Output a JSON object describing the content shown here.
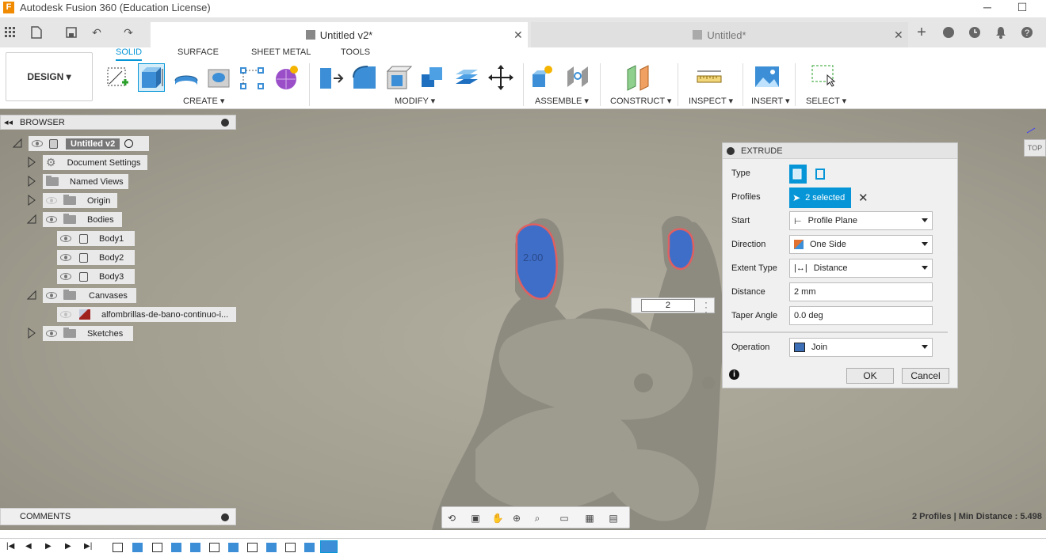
{
  "window": {
    "title": "Autodesk Fusion 360 (Education License)",
    "minimize": "─",
    "maximize": "☐"
  },
  "app_icon": "F",
  "tabs": {
    "active": "Untitled v2*",
    "inactive": "Untitled*",
    "close": "✕",
    "new_tab": "+"
  },
  "ribbon": {
    "design_menu": "DESIGN ▾",
    "tabs": [
      "SOLID",
      "SURFACE",
      "SHEET METAL",
      "TOOLS"
    ],
    "groups": [
      "CREATE ▾",
      "MODIFY ▾",
      "ASSEMBLE ▾",
      "CONSTRUCT ▾",
      "INSPECT ▾",
      "INSERT ▾",
      "SELECT ▾"
    ]
  },
  "browser": {
    "title": "BROWSER",
    "nodes": {
      "root": "Untitled v2",
      "doc_settings": "Document Settings",
      "named_views": "Named Views",
      "origin": "Origin",
      "bodies": "Bodies",
      "body1": "Body1",
      "body2": "Body2",
      "body3": "Body3",
      "canvases": "Canvases",
      "canvas_image": "alfombrillas-de-bano-continuo-i...",
      "sketches": "Sketches"
    }
  },
  "viewport": {
    "dimension_label": "2.00",
    "distance_input": "2",
    "viewcube_label": "TOP"
  },
  "extrude": {
    "title": "EXTRUDE",
    "type_label": "Type",
    "profiles_label": "Profiles",
    "profiles_value": "2 selected",
    "start_label": "Start",
    "start_value": "Profile Plane",
    "direction_label": "Direction",
    "direction_value": "One Side",
    "extent_label": "Extent Type",
    "extent_value": "Distance",
    "distance_label": "Distance",
    "distance_value": "2 mm",
    "taper_label": "Taper Angle",
    "taper_value": "0.0 deg",
    "operation_label": "Operation",
    "operation_value": "Join",
    "ok": "OK",
    "cancel": "Cancel",
    "info": "i"
  },
  "comments": {
    "title": "COMMENTS"
  },
  "status": {
    "text": "2 Profiles | Min Distance : 5.498"
  },
  "colors": {
    "accent": "#0696d7",
    "profile_fill": "#3f6ec9",
    "viewport_bg": "#a19d8f"
  }
}
